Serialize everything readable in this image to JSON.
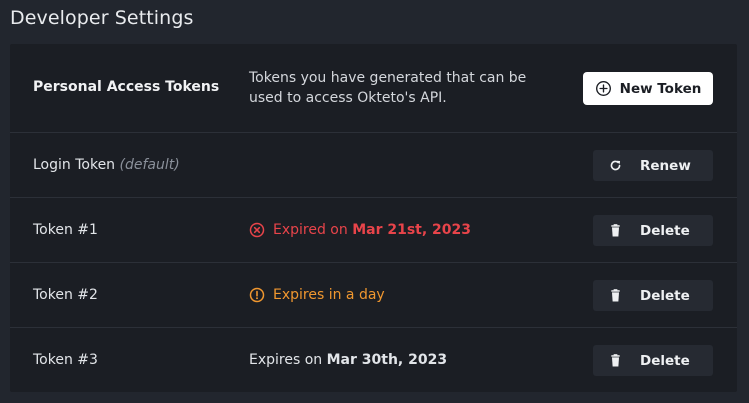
{
  "page": {
    "title": "Developer Settings"
  },
  "tokens_section": {
    "title": "Personal Access Tokens",
    "description": "Tokens you have generated that can be used to access Okteto's API.",
    "new_button_label": "New Token"
  },
  "rows": [
    {
      "name": "Login Token",
      "hint": "(default)",
      "status_prefix": "",
      "status_value": "",
      "status_kind": "none",
      "action_label": "Renew",
      "action_icon": "refresh-icon"
    },
    {
      "name": "Token #1",
      "hint": "",
      "status_prefix": "Expired on ",
      "status_value": "Mar 21st, 2023",
      "status_kind": "expired",
      "action_label": "Delete",
      "action_icon": "trash-icon"
    },
    {
      "name": "Token #2",
      "hint": "",
      "status_prefix": "Expires in a day",
      "status_value": "",
      "status_kind": "soon",
      "action_label": "Delete",
      "action_icon": "trash-icon"
    },
    {
      "name": "Token #3",
      "hint": "",
      "status_prefix": "Expires on ",
      "status_value": "Mar 30th, 2023",
      "status_kind": "normal",
      "action_label": "Delete",
      "action_icon": "trash-icon"
    }
  ],
  "colors": {
    "background": "#22262e",
    "panel": "#1b1e24",
    "expired": "#e8444a",
    "warning": "#f0972f",
    "primary_button": "#ffffff"
  }
}
